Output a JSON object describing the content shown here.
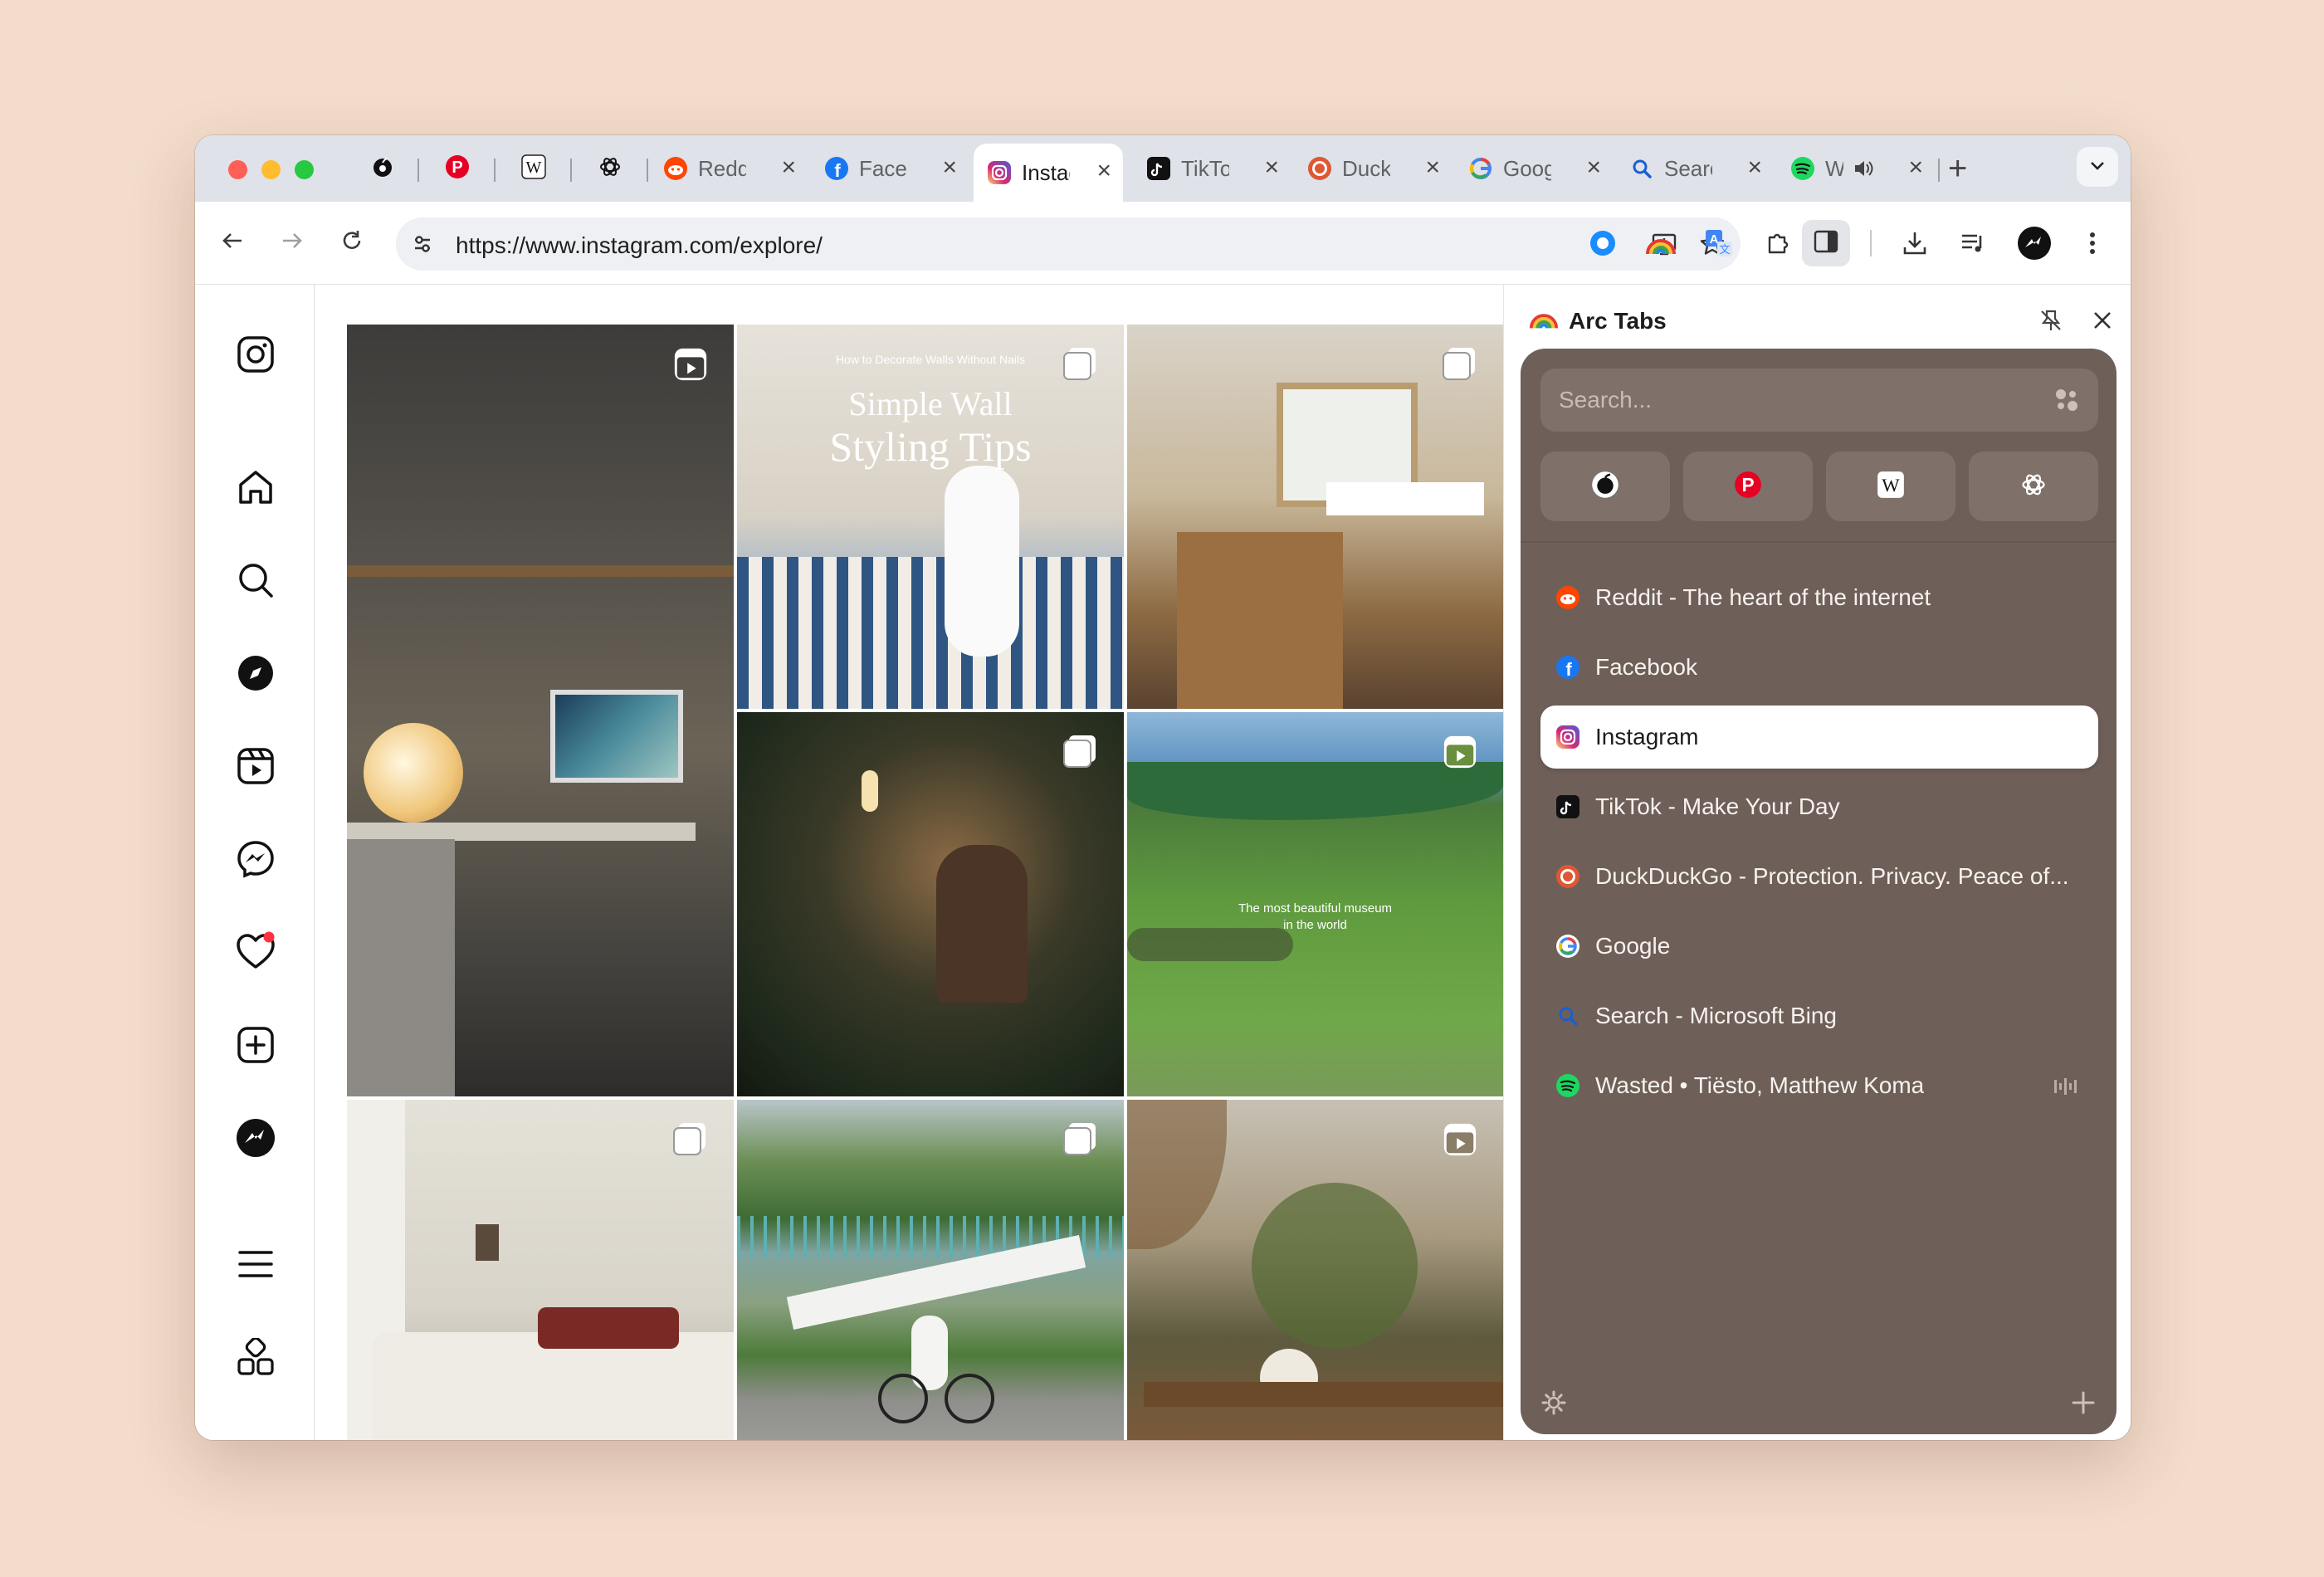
{
  "tabs": [
    {
      "id": "reddit",
      "title": "Reddit - The heart of the internet",
      "short": "Reddit"
    },
    {
      "id": "facebook",
      "title": "Facebook",
      "short": "Facebook"
    },
    {
      "id": "instagram",
      "title": "Instagram",
      "short": "Instagram",
      "active": true
    },
    {
      "id": "tiktok",
      "title": "TikTok - Make Your Day",
      "short": "TikTok"
    },
    {
      "id": "duckduckgo",
      "title": "DuckDuckGo - Protection. Privacy. Peace of...",
      "short": "DuckDuckGo"
    },
    {
      "id": "google",
      "title": "Google",
      "short": "Google"
    },
    {
      "id": "bing",
      "title": "Search - Microsoft Bing",
      "short": "Search"
    },
    {
      "id": "spotify",
      "title": "Wasted • Tiësto, Matthew Koma",
      "short": "Wasted"
    }
  ],
  "toolbar": {
    "url": "https://www.instagram.com/explore/"
  },
  "arc": {
    "title": "Arc Tabs",
    "search_placeholder": "Search...",
    "items": [
      "Reddit - The heart of the internet",
      "Facebook",
      "Instagram",
      "TikTok - Make Your Day",
      "DuckDuckGo - Protection. Privacy. Peace of...",
      "Google",
      "Search - Microsoft Bing",
      "Wasted • Tiësto, Matthew Koma"
    ]
  },
  "posts": [
    {
      "caption": "",
      "type": "reel"
    },
    {
      "caption_small": "How to Decorate Walls Without Nails",
      "caption_big1": "Simple Wall",
      "caption_big2": "Styling Tips",
      "type": "carousel"
    },
    {
      "caption": "",
      "type": "carousel"
    },
    {
      "caption": "",
      "type": "carousel"
    },
    {
      "caption1": "The most beautiful museum",
      "caption2": "in the world",
      "type": "reel"
    },
    {
      "caption": "",
      "type": "carousel"
    },
    {
      "caption": "",
      "type": "carousel"
    },
    {
      "caption": "",
      "type": "reel"
    }
  ],
  "colors": {
    "background": "#f3dccb",
    "arc_card": "#6f5f59",
    "tabstrip": "#dfe2e8"
  }
}
